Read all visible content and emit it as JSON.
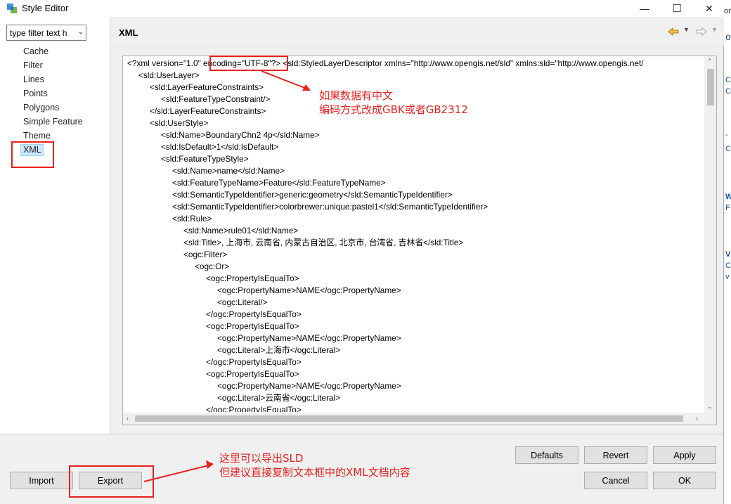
{
  "window": {
    "title": "Style Editor",
    "minimize_glyph": "—",
    "maximize_glyph": "☐",
    "close_glyph": "✕"
  },
  "background_fragments": [
    "on",
    "o",
    "C",
    "C",
    "-",
    "C",
    "W",
    "F",
    "V",
    "C",
    "v"
  ],
  "left_panel": {
    "filter_text": "type filter text h",
    "items": [
      "Cache",
      "Filter",
      "Lines",
      "Points",
      "Polygons",
      "Simple Feature",
      "Theme",
      "XML"
    ],
    "selected": "XML"
  },
  "header": {
    "title": "XML",
    "icons": [
      "back-arrow-icon",
      "dropdown-icon",
      "forward-arrow-icon",
      "dropdown-icon"
    ]
  },
  "xml": {
    "lines": [
      {
        "indent": 0,
        "text": "<?xml version=\"1.0\" encoding=\"UTF-8\"?> <sld:StyledLayerDescriptor xmlns=\"http://www.opengis.net/sld\" xmlns:sld=\"http://www.opengis.net/"
      },
      {
        "indent": 1,
        "text": "<sld:UserLayer>"
      },
      {
        "indent": 2,
        "text": "<sld:LayerFeatureConstraints>"
      },
      {
        "indent": 3,
        "text": "<sld:FeatureTypeConstraint/>"
      },
      {
        "indent": 2,
        "text": "</sld:LayerFeatureConstraints>"
      },
      {
        "indent": 2,
        "text": "<sld:UserStyle>"
      },
      {
        "indent": 3,
        "text": "<sld:Name>BoundaryChn2 4p</sld:Name>"
      },
      {
        "indent": 3,
        "text": "<sld:IsDefault>1</sld:IsDefault>"
      },
      {
        "indent": 3,
        "text": "<sld:FeatureTypeStyle>"
      },
      {
        "indent": 4,
        "text": "<sld:Name>name</sld:Name>"
      },
      {
        "indent": 4,
        "text": "<sld:FeatureTypeName>Feature</sld:FeatureTypeName>"
      },
      {
        "indent": 4,
        "text": "<sld:SemanticTypeIdentifier>generic:geometry</sld:SemanticTypeIdentifier>"
      },
      {
        "indent": 4,
        "text": "<sld:SemanticTypeIdentifier>colorbrewer:unique:pastel1</sld:SemanticTypeIdentifier>"
      },
      {
        "indent": 4,
        "text": "<sld:Rule>"
      },
      {
        "indent": 5,
        "text": "<sld:Name>rule01</sld:Name>"
      },
      {
        "indent": 5,
        "text": "<sld:Title>, 上海市, 云南省, 内蒙古自治区, 北京市, 台湾省, 吉林省</sld:Title>"
      },
      {
        "indent": 5,
        "text": "<ogc:Filter>"
      },
      {
        "indent": 6,
        "text": "<ogc:Or>"
      },
      {
        "indent": 7,
        "text": "<ogc:PropertyIsEqualTo>"
      },
      {
        "indent": 8,
        "text": "<ogc:PropertyName>NAME</ogc:PropertyName>"
      },
      {
        "indent": 8,
        "text": "<ogc:Literal/>"
      },
      {
        "indent": 7,
        "text": "</ogc:PropertyIsEqualTo>"
      },
      {
        "indent": 7,
        "text": "<ogc:PropertyIsEqualTo>"
      },
      {
        "indent": 8,
        "text": "<ogc:PropertyName>NAME</ogc:PropertyName>"
      },
      {
        "indent": 8,
        "text": "<ogc:Literal>上海市</ogc:Literal>"
      },
      {
        "indent": 7,
        "text": "</ogc:PropertyIsEqualTo>"
      },
      {
        "indent": 7,
        "text": "<ogc:PropertyIsEqualTo>"
      },
      {
        "indent": 8,
        "text": "<ogc:PropertyName>NAME</ogc:PropertyName>"
      },
      {
        "indent": 8,
        "text": "<ogc:Literal>云南省</ogc:Literal>"
      },
      {
        "indent": 7,
        "text": "</ogc:PropertyIsEqualTo>"
      }
    ]
  },
  "buttons": {
    "defaults": "Defaults",
    "revert": "Revert",
    "apply": "Apply",
    "import": "Import",
    "export": "Export",
    "cancel": "Cancel",
    "ok": "OK"
  },
  "annotations": {
    "encoding_note_1": "如果数据有中文",
    "encoding_note_2": "编码方式改成GBK或者GB2312",
    "export_note_1": "这里可以导出SLD",
    "export_note_2": "但建议直接复制文本框中的XML文档内容",
    "color": "#e8211d"
  }
}
